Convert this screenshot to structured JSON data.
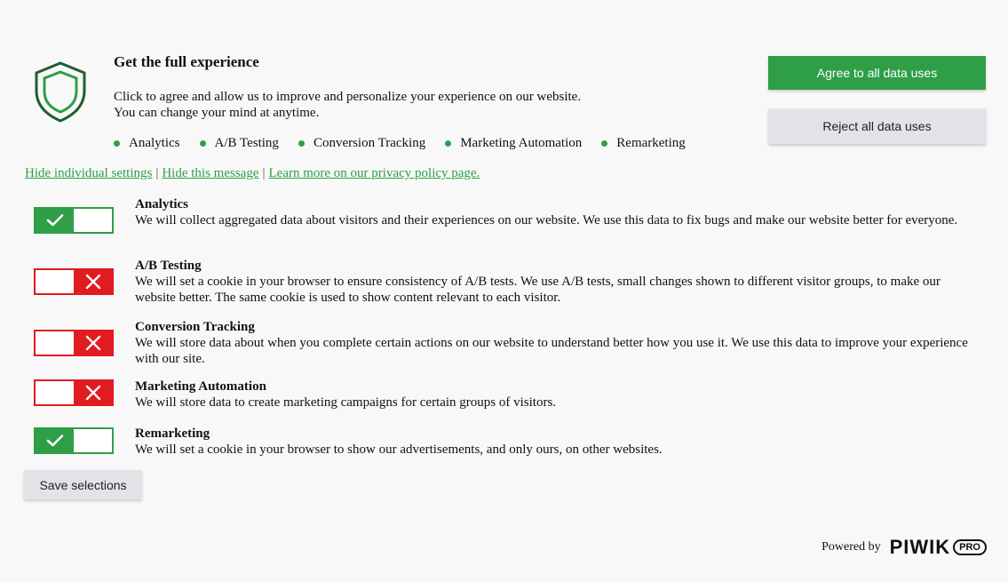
{
  "header": {
    "title": "Get the full experience",
    "description_line1": "Click to agree and allow us to improve and personalize your experience on our website.",
    "description_line2": "You can change your mind at anytime."
  },
  "categories": [
    "Analytics",
    "A/B Testing",
    "Conversion Tracking",
    "Marketing Automation",
    "Remarketing"
  ],
  "buttons": {
    "agree_label": "Agree to all data uses",
    "reject_label": "Reject all data uses",
    "save_label": "Save selections"
  },
  "links": {
    "hide_settings": "Hide individual settings",
    "separator": "|",
    "hide_message": "Hide this message",
    "privacy": "Learn more on our privacy policy page."
  },
  "settings": [
    {
      "name": "Analytics",
      "enabled": true,
      "description": "We will collect aggregated data about visitors and their experiences on our website. We use this data to fix bugs and make our website better for everyone."
    },
    {
      "name": "A/B Testing",
      "enabled": false,
      "description": "We will set a cookie in your browser to ensure consistency of A/B tests. We use A/B tests, small changes shown to different visitor groups, to make our website better. The same cookie is used to show content relevant to each visitor."
    },
    {
      "name": "Conversion Tracking",
      "enabled": false,
      "description": "We will store data about when you complete certain actions on our website to understand better how you use it. We use this data to improve your experience with our site."
    },
    {
      "name": "Marketing Automation",
      "enabled": false,
      "description": "We will store data to create marketing campaigns for certain groups of visitors."
    },
    {
      "name": "Remarketing",
      "enabled": true,
      "description": "We will set a cookie in your browser to show our advertisements, and only ours, on other websites."
    }
  ],
  "footer": {
    "powered_by": "Powered by",
    "brand": "PIWIK",
    "brand_suffix": "PRO"
  },
  "colors": {
    "accent_green": "#2e9e47",
    "off_red": "#e01b22",
    "button_gray": "#e1e3e6",
    "background": "#f8f8f8"
  },
  "icons": {
    "shield": "shield-icon",
    "check": "check-icon",
    "cross": "close-icon"
  }
}
